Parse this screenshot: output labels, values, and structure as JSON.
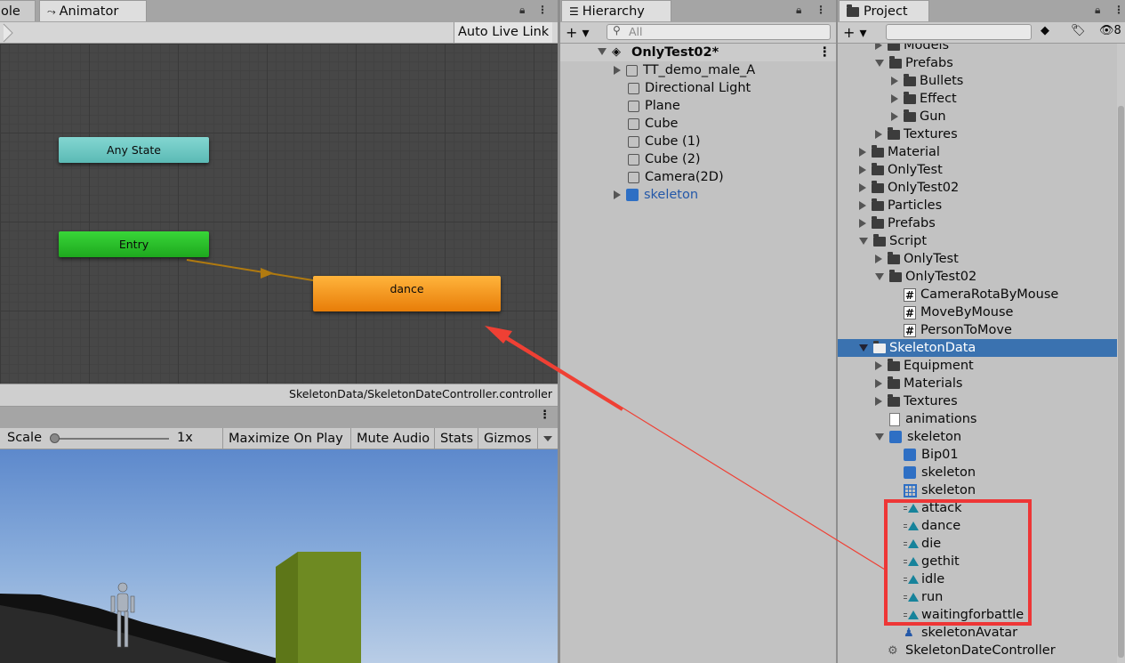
{
  "animator": {
    "tab_prev": "ole",
    "tab_label": "Animator",
    "auto_live_link": "Auto Live Link",
    "states": {
      "any_state": "Any State",
      "entry": "Entry",
      "dance": "dance"
    },
    "footer_path": "SkeletonData/SkeletonDateController.controller"
  },
  "game": {
    "scale_label": "Scale",
    "scale_value": "1x",
    "buttons": [
      "Maximize On Play",
      "Mute Audio",
      "Stats",
      "Gizmos"
    ]
  },
  "hierarchy": {
    "tab_label": "Hierarchy",
    "search_placeholder": "All",
    "scene_name": "OnlyTest02*",
    "items": [
      "TT_demo_male_A",
      "Directional Light",
      "Plane",
      "Cube",
      "Cube (1)",
      "Cube (2)",
      "Camera(2D)",
      "skeleton"
    ]
  },
  "project": {
    "tab_label": "Project",
    "hidden_count": "8",
    "items": [
      "Models",
      "Prefabs",
      "Bullets",
      "Effect",
      "Gun",
      "Textures",
      "Material",
      "OnlyTest",
      "OnlyTest02",
      "Particles",
      "Prefabs",
      "Script",
      "OnlyTest",
      "OnlyTest02",
      "CameraRotaByMouse",
      "MoveByMouse",
      "PersonToMove",
      "SkeletonData",
      "Equipment",
      "Materials",
      "Textures",
      "animations",
      "skeleton",
      "Bip01",
      "skeleton",
      "skeleton",
      "attack",
      "dance",
      "die",
      "gethit",
      "idle",
      "run",
      "waitingforbattle",
      "skeletonAvatar",
      "SkeletonDateController"
    ]
  },
  "colors": {
    "selection": "#3a72b0",
    "highlight_box": "#ee3636",
    "arrow": "#ef4034",
    "any_state": "#6fc9c4",
    "entry": "#2ec02e",
    "dance": "#f08a12",
    "prefab_blue": "#2458a8"
  }
}
